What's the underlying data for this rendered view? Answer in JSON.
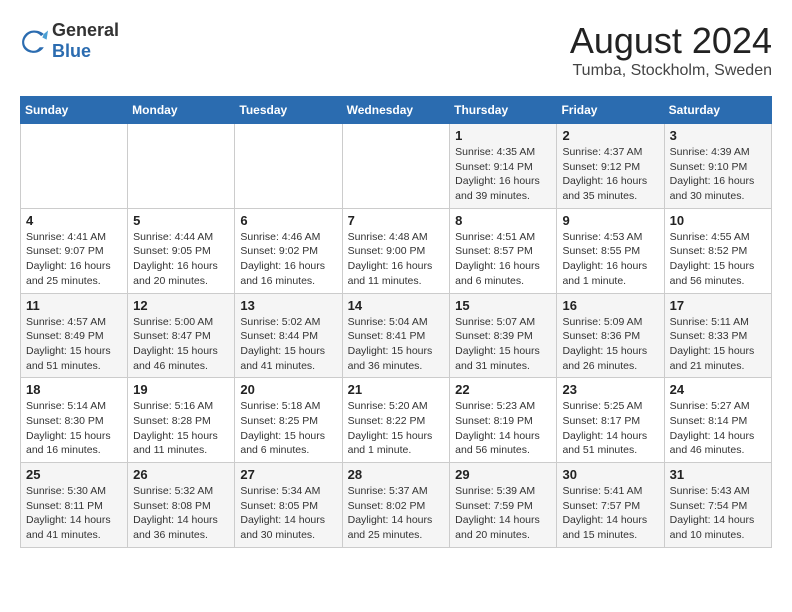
{
  "header": {
    "logo_general": "General",
    "logo_blue": "Blue",
    "month_year": "August 2024",
    "location": "Tumba, Stockholm, Sweden"
  },
  "days_of_week": [
    "Sunday",
    "Monday",
    "Tuesday",
    "Wednesday",
    "Thursday",
    "Friday",
    "Saturday"
  ],
  "weeks": [
    [
      {
        "day": "",
        "detail": ""
      },
      {
        "day": "",
        "detail": ""
      },
      {
        "day": "",
        "detail": ""
      },
      {
        "day": "",
        "detail": ""
      },
      {
        "day": "1",
        "detail": "Sunrise: 4:35 AM\nSunset: 9:14 PM\nDaylight: 16 hours\nand 39 minutes."
      },
      {
        "day": "2",
        "detail": "Sunrise: 4:37 AM\nSunset: 9:12 PM\nDaylight: 16 hours\nand 35 minutes."
      },
      {
        "day": "3",
        "detail": "Sunrise: 4:39 AM\nSunset: 9:10 PM\nDaylight: 16 hours\nand 30 minutes."
      }
    ],
    [
      {
        "day": "4",
        "detail": "Sunrise: 4:41 AM\nSunset: 9:07 PM\nDaylight: 16 hours\nand 25 minutes."
      },
      {
        "day": "5",
        "detail": "Sunrise: 4:44 AM\nSunset: 9:05 PM\nDaylight: 16 hours\nand 20 minutes."
      },
      {
        "day": "6",
        "detail": "Sunrise: 4:46 AM\nSunset: 9:02 PM\nDaylight: 16 hours\nand 16 minutes."
      },
      {
        "day": "7",
        "detail": "Sunrise: 4:48 AM\nSunset: 9:00 PM\nDaylight: 16 hours\nand 11 minutes."
      },
      {
        "day": "8",
        "detail": "Sunrise: 4:51 AM\nSunset: 8:57 PM\nDaylight: 16 hours\nand 6 minutes."
      },
      {
        "day": "9",
        "detail": "Sunrise: 4:53 AM\nSunset: 8:55 PM\nDaylight: 16 hours\nand 1 minute."
      },
      {
        "day": "10",
        "detail": "Sunrise: 4:55 AM\nSunset: 8:52 PM\nDaylight: 15 hours\nand 56 minutes."
      }
    ],
    [
      {
        "day": "11",
        "detail": "Sunrise: 4:57 AM\nSunset: 8:49 PM\nDaylight: 15 hours\nand 51 minutes."
      },
      {
        "day": "12",
        "detail": "Sunrise: 5:00 AM\nSunset: 8:47 PM\nDaylight: 15 hours\nand 46 minutes."
      },
      {
        "day": "13",
        "detail": "Sunrise: 5:02 AM\nSunset: 8:44 PM\nDaylight: 15 hours\nand 41 minutes."
      },
      {
        "day": "14",
        "detail": "Sunrise: 5:04 AM\nSunset: 8:41 PM\nDaylight: 15 hours\nand 36 minutes."
      },
      {
        "day": "15",
        "detail": "Sunrise: 5:07 AM\nSunset: 8:39 PM\nDaylight: 15 hours\nand 31 minutes."
      },
      {
        "day": "16",
        "detail": "Sunrise: 5:09 AM\nSunset: 8:36 PM\nDaylight: 15 hours\nand 26 minutes."
      },
      {
        "day": "17",
        "detail": "Sunrise: 5:11 AM\nSunset: 8:33 PM\nDaylight: 15 hours\nand 21 minutes."
      }
    ],
    [
      {
        "day": "18",
        "detail": "Sunrise: 5:14 AM\nSunset: 8:30 PM\nDaylight: 15 hours\nand 16 minutes."
      },
      {
        "day": "19",
        "detail": "Sunrise: 5:16 AM\nSunset: 8:28 PM\nDaylight: 15 hours\nand 11 minutes."
      },
      {
        "day": "20",
        "detail": "Sunrise: 5:18 AM\nSunset: 8:25 PM\nDaylight: 15 hours\nand 6 minutes."
      },
      {
        "day": "21",
        "detail": "Sunrise: 5:20 AM\nSunset: 8:22 PM\nDaylight: 15 hours\nand 1 minute."
      },
      {
        "day": "22",
        "detail": "Sunrise: 5:23 AM\nSunset: 8:19 PM\nDaylight: 14 hours\nand 56 minutes."
      },
      {
        "day": "23",
        "detail": "Sunrise: 5:25 AM\nSunset: 8:17 PM\nDaylight: 14 hours\nand 51 minutes."
      },
      {
        "day": "24",
        "detail": "Sunrise: 5:27 AM\nSunset: 8:14 PM\nDaylight: 14 hours\nand 46 minutes."
      }
    ],
    [
      {
        "day": "25",
        "detail": "Sunrise: 5:30 AM\nSunset: 8:11 PM\nDaylight: 14 hours\nand 41 minutes."
      },
      {
        "day": "26",
        "detail": "Sunrise: 5:32 AM\nSunset: 8:08 PM\nDaylight: 14 hours\nand 36 minutes."
      },
      {
        "day": "27",
        "detail": "Sunrise: 5:34 AM\nSunset: 8:05 PM\nDaylight: 14 hours\nand 30 minutes."
      },
      {
        "day": "28",
        "detail": "Sunrise: 5:37 AM\nSunset: 8:02 PM\nDaylight: 14 hours\nand 25 minutes."
      },
      {
        "day": "29",
        "detail": "Sunrise: 5:39 AM\nSunset: 7:59 PM\nDaylight: 14 hours\nand 20 minutes."
      },
      {
        "day": "30",
        "detail": "Sunrise: 5:41 AM\nSunset: 7:57 PM\nDaylight: 14 hours\nand 15 minutes."
      },
      {
        "day": "31",
        "detail": "Sunrise: 5:43 AM\nSunset: 7:54 PM\nDaylight: 14 hours\nand 10 minutes."
      }
    ]
  ]
}
